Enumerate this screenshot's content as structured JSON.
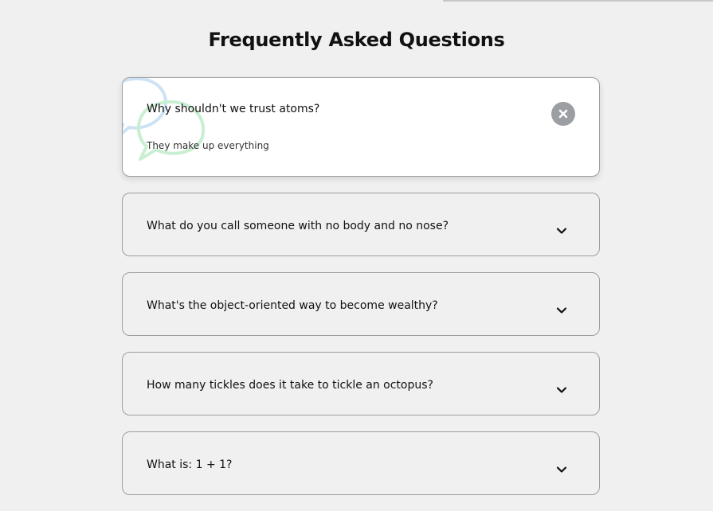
{
  "page": {
    "title": "Frequently Asked Questions"
  },
  "faqs": [
    {
      "question": "Why shouldn't we trust atoms?",
      "answer": "They make up everything",
      "state": "open",
      "toggle_icon": "close-icon"
    },
    {
      "question": "What do you call someone with no body and no nose?",
      "state": "collapsed",
      "toggle_icon": "chevron-down-icon"
    },
    {
      "question": "What's the object-oriented way to become wealthy?",
      "state": "collapsed",
      "toggle_icon": "chevron-down-icon"
    },
    {
      "question": "How many tickles does it take to tickle an octopus?",
      "state": "collapsed",
      "toggle_icon": "chevron-down-icon"
    },
    {
      "question": "What is: 1 + 1?",
      "state": "collapsed",
      "toggle_icon": "chevron-down-icon"
    }
  ],
  "colors": {
    "background": "#f0f0f0",
    "card_open": "#ffffff",
    "border": "#9e9e9e",
    "close_button": "#9b9ea2",
    "bubble_blue": "#cde3f5",
    "bubble_green": "#c9efd3"
  }
}
